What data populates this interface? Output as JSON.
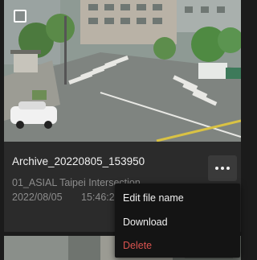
{
  "card": {
    "title": "Archive_20220805_153950",
    "camera": "01_ASIAL Taipei Intersection",
    "date": "2022/08/05",
    "time": "15:46:2"
  },
  "menu": {
    "items": [
      {
        "label": "Edit file name"
      },
      {
        "label": "Download"
      },
      {
        "label": "Delete"
      }
    ]
  },
  "colors": {
    "delete": "#d9534f",
    "background": "#1b1b1b",
    "card": "#2b2b2b",
    "menu": "#141414"
  },
  "icons": {
    "select": "checkbox-icon",
    "more": "more-horizontal-icon"
  }
}
